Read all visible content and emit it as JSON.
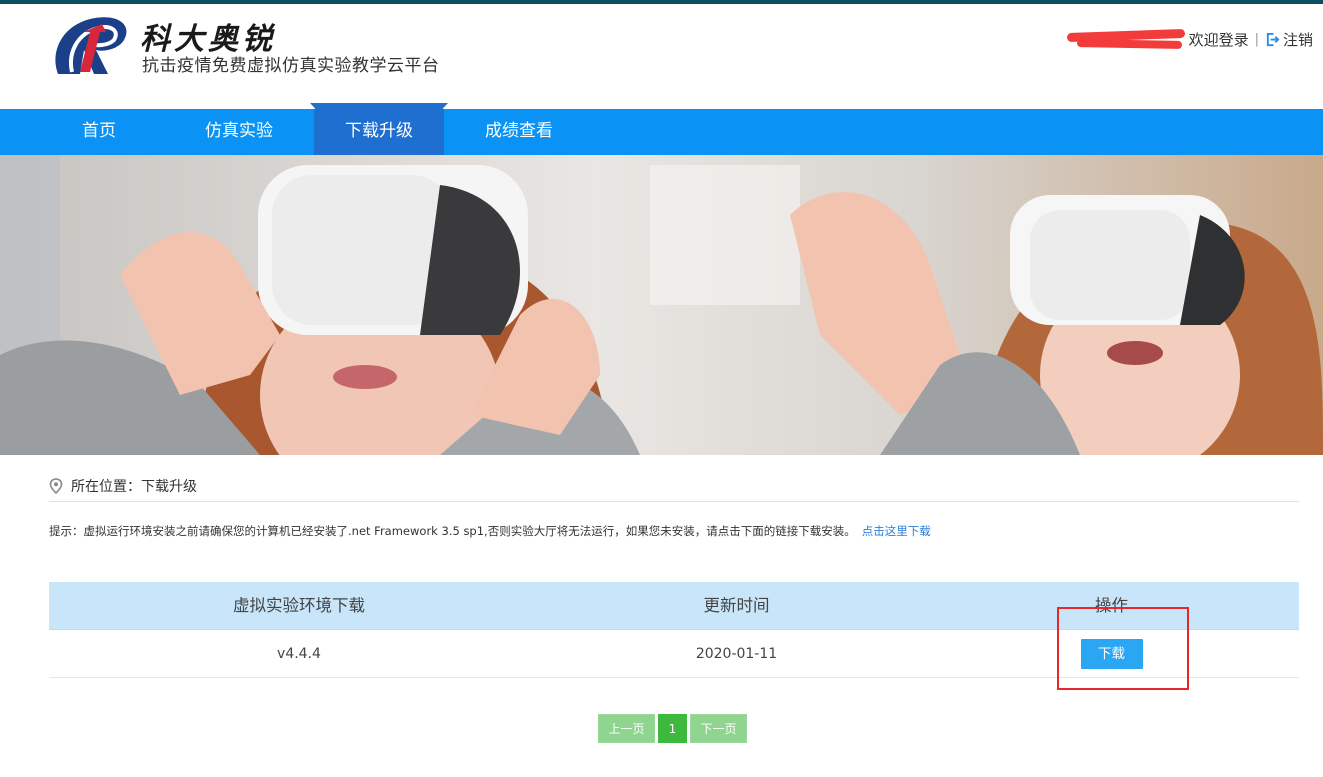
{
  "header": {
    "logo_title": "科大奥锐",
    "logo_subtitle": "抗击疫情免费虚拟仿真实验教学云平台",
    "welcome_text": "欢迎登录",
    "separator": "|",
    "logout_label": "注销"
  },
  "nav": {
    "items": [
      {
        "label": "首页"
      },
      {
        "label": "仿真实验"
      },
      {
        "label": "下载升级"
      },
      {
        "label": "成绩查看"
      }
    ],
    "active": "下载升级"
  },
  "breadcrumb": {
    "text": "所在位置：下载升级"
  },
  "tip": {
    "text": "提示：虚拟运行环境安装之前请确保您的计算机已经安装了.net Framework 3.5 sp1,否则实验大厅将无法运行，如果您未安装，请点击下面的链接下载安装。",
    "link_label": "点击这里下载"
  },
  "table": {
    "headers": [
      "虚拟实验环境下载",
      "更新时间",
      "操作"
    ],
    "rows": [
      {
        "version": "v4.4.4",
        "date": "2020-01-11",
        "action": "下载"
      }
    ]
  },
  "pager": {
    "prev": "上一页",
    "current": "1",
    "next": "下一页"
  },
  "colors": {
    "nav_bg": "#0a93f5",
    "nav_active": "#1f6fd1",
    "table_header_bg": "#c9e5fa",
    "download_button": "#2aa6f2",
    "pager_green": "#8fd58f",
    "highlight_box": "#e8262c"
  }
}
